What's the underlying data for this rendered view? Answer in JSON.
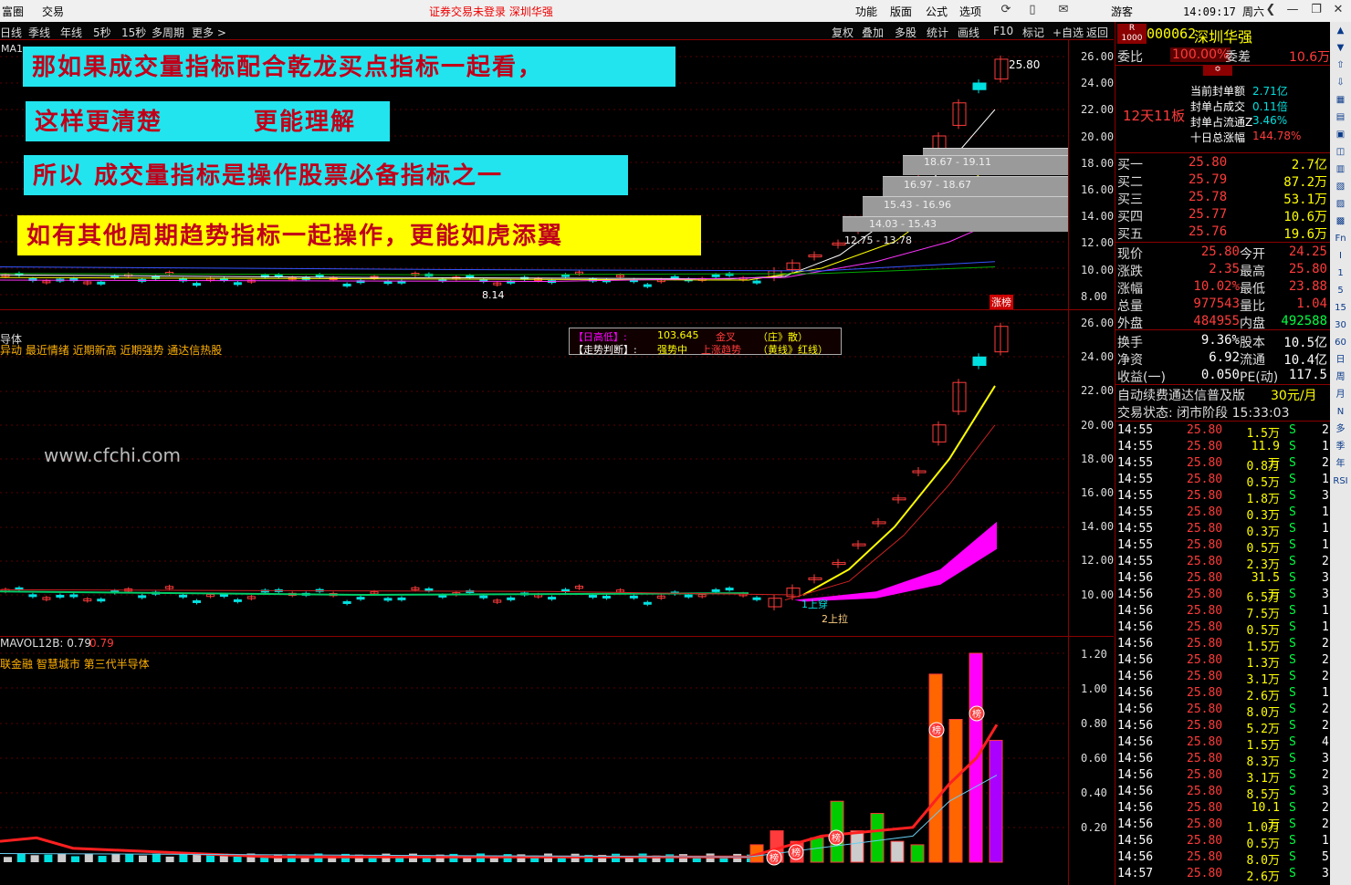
{
  "topbar": {
    "menu_left": [
      "富圈",
      "交易"
    ],
    "status": "证券交易未登录   深圳华强",
    "menu_right": [
      "功能",
      "版面",
      "公式",
      "选项"
    ],
    "user": "游客",
    "clock": "14:09:17 周六"
  },
  "period_bar": {
    "periods": [
      "日线",
      "季线",
      "年线",
      "5秒",
      "15秒",
      "多周期",
      "更多 >"
    ],
    "tools": [
      "复权",
      "叠加",
      "多股",
      "统计",
      "画线",
      "F10",
      "标记",
      "+自选",
      "返回"
    ]
  },
  "main_pane": {
    "indicator_label": "MA1",
    "axis": [
      "26.00",
      "24.00",
      "22.00",
      "20.00",
      "18.00",
      "16.00",
      "14.00",
      "12.00",
      "10.00",
      "8.00"
    ],
    "high_label": "25.80",
    "low_label": "8.14",
    "badge": "涨榜",
    "volume_profile": [
      "18.67 - 19.11",
      "16.97 - 18.67",
      "15.43 - 16.96",
      "14.03 - 15.43",
      "12.75 - 13.78"
    ]
  },
  "captions": [
    "那如果成交量指标配合乾龙买点指标一起看，",
    "这样更清楚",
    "更能理解",
    "所以 成交量指标是操作股票必备指标之一",
    "如有其他周期趋势指标一起操作，更能如虎添翼"
  ],
  "mid_pane": {
    "title": "导体",
    "tags": "异动 最近情绪 近期新高 近期强势 通达信热股",
    "watermark": "www.cfchi.com",
    "info_line1_key": "【日高低】:",
    "info_line1_val": "103.645",
    "info_line1_tag": "金叉",
    "info_line1_note": "（庄》散）",
    "info_line2_key": "【走势判断】:",
    "info_line2_val": "强势中",
    "info_line2_tag": "上涨趋势",
    "info_line2_note": "（黄线》红线）",
    "axis": [
      "26.00",
      "24.00",
      "22.00",
      "20.00",
      "18.00",
      "16.00",
      "14.00",
      "12.00",
      "10.00"
    ],
    "marker1": "1上穿",
    "marker2": "2上拉"
  },
  "vol_pane": {
    "title": "MAVOL12B: 0.79",
    "title_val": "0.79",
    "tags": "联金融 智慧城市 第三代半导体",
    "axis": [
      "1.20",
      "1.00",
      "0.80",
      "0.60",
      "0.40",
      "0.20"
    ],
    "badge": "榜"
  },
  "quote": {
    "code": "000062",
    "name": "深圳华强",
    "code_prefix": "R",
    "code_sub": "1000",
    "wb_label": "委比",
    "wb_val": "100.00%",
    "wc_label": "委差",
    "wc_val": "10.6万",
    "streak": "12天11板",
    "seal_rows": [
      {
        "label": "当前封单额",
        "val": "2.71亿"
      },
      {
        "label": "封单占成交",
        "val": "0.11倍"
      },
      {
        "label": "封单占流通Z",
        "val": "3.46%"
      },
      {
        "label": "十日总涨幅",
        "val": "144.78%"
      }
    ],
    "bids": [
      {
        "label": "买一",
        "price": "25.80",
        "vol": "2.7亿"
      },
      {
        "label": "买二",
        "price": "25.79",
        "vol": "87.2万"
      },
      {
        "label": "买三",
        "price": "25.78",
        "vol": "53.1万"
      },
      {
        "label": "买四",
        "price": "25.77",
        "vol": "10.6万"
      },
      {
        "label": "买五",
        "price": "25.76",
        "vol": "19.6万"
      }
    ],
    "stats": [
      {
        "l1": "现价",
        "v1": "25.80",
        "l2": "今开",
        "v2": "24.25"
      },
      {
        "l1": "涨跌",
        "v1": "2.35",
        "l2": "最高",
        "v2": "25.80"
      },
      {
        "l1": "涨幅",
        "v1": "10.02%",
        "l2": "最低",
        "v2": "23.88"
      },
      {
        "l1": "总量",
        "v1": "977543",
        "l2": "量比",
        "v2": "1.04"
      },
      {
        "l1": "外盘",
        "v1": "484955",
        "l2": "内盘",
        "v2": "492588"
      }
    ],
    "stats2": [
      {
        "l1": "换手",
        "v1": "9.36%",
        "l2": "股本",
        "v2": "10.5亿"
      },
      {
        "l1": "净资",
        "v1": "6.92",
        "l2": "流通",
        "v2": "10.4亿"
      },
      {
        "l1": "收益(一)",
        "v1": "0.050",
        "l2": "PE(动)",
        "v2": "117.5"
      }
    ],
    "promo": "自动续费通达信普及版",
    "promo_price": "30元/月",
    "trade_state": "交易状态: 闭市阶段 15:33:03"
  },
  "ticks": [
    {
      "t": "14:55",
      "p": "25.80",
      "v": "1.5万",
      "s": "S",
      "n": "2"
    },
    {
      "t": "14:55",
      "p": "25.80",
      "v": "11.9万",
      "s": "S",
      "n": "1"
    },
    {
      "t": "14:55",
      "p": "25.80",
      "v": "0.8万",
      "s": "S",
      "n": "2"
    },
    {
      "t": "14:55",
      "p": "25.80",
      "v": "0.5万",
      "s": "S",
      "n": "1"
    },
    {
      "t": "14:55",
      "p": "25.80",
      "v": "1.8万",
      "s": "S",
      "n": "3"
    },
    {
      "t": "14:55",
      "p": "25.80",
      "v": "0.3万",
      "s": "S",
      "n": "1"
    },
    {
      "t": "14:55",
      "p": "25.80",
      "v": "0.3万",
      "s": "S",
      "n": "1"
    },
    {
      "t": "14:55",
      "p": "25.80",
      "v": "0.5万",
      "s": "S",
      "n": "1"
    },
    {
      "t": "14:55",
      "p": "25.80",
      "v": "2.3万",
      "s": "S",
      "n": "2"
    },
    {
      "t": "14:56",
      "p": "25.80",
      "v": "31.5万",
      "s": "S",
      "n": "3"
    },
    {
      "t": "14:56",
      "p": "25.80",
      "v": "6.5万",
      "s": "S",
      "n": "3"
    },
    {
      "t": "14:56",
      "p": "25.80",
      "v": "7.5万",
      "s": "S",
      "n": "1"
    },
    {
      "t": "14:56",
      "p": "25.80",
      "v": "0.5万",
      "s": "S",
      "n": "1"
    },
    {
      "t": "14:56",
      "p": "25.80",
      "v": "1.5万",
      "s": "S",
      "n": "2"
    },
    {
      "t": "14:56",
      "p": "25.80",
      "v": "1.3万",
      "s": "S",
      "n": "2"
    },
    {
      "t": "14:56",
      "p": "25.80",
      "v": "3.1万",
      "s": "S",
      "n": "2"
    },
    {
      "t": "14:56",
      "p": "25.80",
      "v": "2.6万",
      "s": "S",
      "n": "1"
    },
    {
      "t": "14:56",
      "p": "25.80",
      "v": "8.0万",
      "s": "S",
      "n": "2"
    },
    {
      "t": "14:56",
      "p": "25.80",
      "v": "5.2万",
      "s": "S",
      "n": "2"
    },
    {
      "t": "14:56",
      "p": "25.80",
      "v": "1.5万",
      "s": "S",
      "n": "4"
    },
    {
      "t": "14:56",
      "p": "25.80",
      "v": "8.3万",
      "s": "S",
      "n": "3"
    },
    {
      "t": "14:56",
      "p": "25.80",
      "v": "3.1万",
      "s": "S",
      "n": "2"
    },
    {
      "t": "14:56",
      "p": "25.80",
      "v": "8.5万",
      "s": "S",
      "n": "3"
    },
    {
      "t": "14:56",
      "p": "25.80",
      "v": "10.1万",
      "s": "S",
      "n": "2"
    },
    {
      "t": "14:56",
      "p": "25.80",
      "v": "1.0万",
      "s": "S",
      "n": "2"
    },
    {
      "t": "14:56",
      "p": "25.80",
      "v": "0.5万",
      "s": "S",
      "n": "1"
    },
    {
      "t": "14:56",
      "p": "25.80",
      "v": "8.0万",
      "s": "S",
      "n": "5"
    },
    {
      "t": "14:57",
      "p": "25.80",
      "v": "2.6万",
      "s": "S",
      "n": "3"
    }
  ],
  "right_toolbar": [
    "Fn",
    "I",
    "1",
    "5",
    "15",
    "30",
    "60",
    "日",
    "周",
    "月",
    "N",
    "多",
    "季",
    "年",
    "RSI"
  ],
  "colors": {
    "up": "#ff3b3b",
    "down": "#00e0e0",
    "yellow": "#ffff00",
    "magenta": "#ff00ff",
    "accent": "#8b0000"
  }
}
